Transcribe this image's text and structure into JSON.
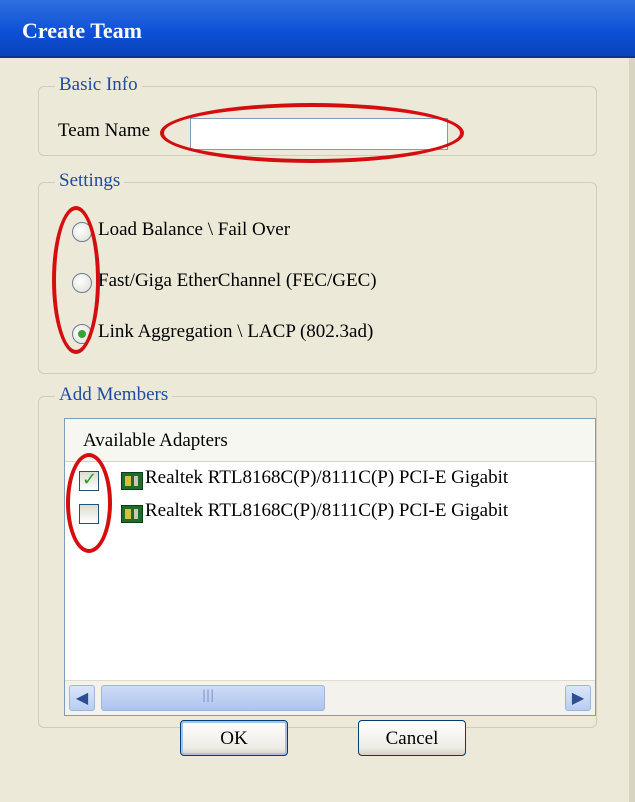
{
  "window": {
    "title": "Create Team"
  },
  "basic_info": {
    "legend": "Basic Info",
    "team_name_label": "Team Name",
    "team_name_value": ""
  },
  "settings": {
    "legend": "Settings",
    "options": [
      {
        "label": "Load Balance \\ Fail Over",
        "selected": false
      },
      {
        "label": "Fast/Giga EtherChannel (FEC/GEC)",
        "selected": false
      },
      {
        "label": "Link Aggregation \\ LACP (802.3ad)",
        "selected": true
      }
    ]
  },
  "add_members": {
    "legend": "Add Members",
    "list_header": "Available Adapters",
    "adapters": [
      {
        "label": "Realtek RTL8168C(P)/8111C(P) PCI-E Gigabit",
        "checked": true
      },
      {
        "label": "Realtek RTL8168C(P)/8111C(P) PCI-E Gigabit",
        "checked": false
      }
    ],
    "scroll_grip": "|||"
  },
  "buttons": {
    "ok": "OK",
    "cancel": "Cancel"
  },
  "colors": {
    "title_bar": "#0c4fd6",
    "legend_text": "#1e4aa6",
    "highlight_marker": "#d40e0e",
    "radio_selected": "#36a336"
  }
}
